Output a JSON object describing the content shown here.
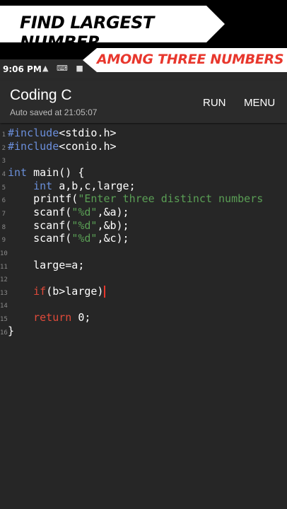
{
  "banners": {
    "top": "FIND LARGEST NUMBER",
    "second": "AMONG THREE NUMBERS"
  },
  "status_bar": {
    "time": "9:06 PM",
    "icons": [
      "notification-icon",
      "keyboard-icon",
      "video-icon"
    ]
  },
  "app": {
    "title": "Coding C",
    "subtitle": "Auto saved at 21:05:07",
    "run_label": "RUN",
    "menu_label": "MENU"
  },
  "code": [
    {
      "n": "1",
      "segments": [
        {
          "t": "#include",
          "c": "inc"
        },
        {
          "t": "<stdio.h>",
          "c": ""
        }
      ]
    },
    {
      "n": "2",
      "segments": [
        {
          "t": "#include",
          "c": "inc"
        },
        {
          "t": "<conio.h>",
          "c": ""
        }
      ]
    },
    {
      "n": "3",
      "segments": []
    },
    {
      "n": "4",
      "segments": [
        {
          "t": "int",
          "c": "kw"
        },
        {
          "t": " main() {",
          "c": ""
        }
      ]
    },
    {
      "n": "5",
      "segments": [
        {
          "t": "    ",
          "c": ""
        },
        {
          "t": "int",
          "c": "kw"
        },
        {
          "t": " a,b,c,large;",
          "c": ""
        }
      ]
    },
    {
      "n": "6",
      "segments": [
        {
          "t": "    printf(",
          "c": ""
        },
        {
          "t": "\"Enter three distinct numbers",
          "c": "str"
        }
      ]
    },
    {
      "n": "7",
      "segments": [
        {
          "t": "    scanf(",
          "c": ""
        },
        {
          "t": "\"%d\"",
          "c": "str"
        },
        {
          "t": ",&a);",
          "c": ""
        }
      ]
    },
    {
      "n": "8",
      "segments": [
        {
          "t": "    scanf(",
          "c": ""
        },
        {
          "t": "\"%d\"",
          "c": "str"
        },
        {
          "t": ",&b);",
          "c": ""
        }
      ]
    },
    {
      "n": "9",
      "segments": [
        {
          "t": "    scanf(",
          "c": ""
        },
        {
          "t": "\"%d\"",
          "c": "str"
        },
        {
          "t": ",&c);",
          "c": ""
        }
      ]
    },
    {
      "n": "10",
      "segments": []
    },
    {
      "n": "11",
      "segments": [
        {
          "t": "    large=a;",
          "c": ""
        }
      ]
    },
    {
      "n": "12",
      "segments": []
    },
    {
      "n": "13",
      "segments": [
        {
          "t": "    ",
          "c": ""
        },
        {
          "t": "if",
          "c": "red"
        },
        {
          "t": "(b>large)",
          "c": ""
        }
      ],
      "cursor": true
    },
    {
      "n": "14",
      "segments": []
    },
    {
      "n": "15",
      "segments": [
        {
          "t": "    ",
          "c": ""
        },
        {
          "t": "return",
          "c": "red"
        },
        {
          "t": " 0;",
          "c": ""
        }
      ]
    },
    {
      "n": "16",
      "segments": [
        {
          "t": "}",
          "c": ""
        }
      ]
    }
  ]
}
